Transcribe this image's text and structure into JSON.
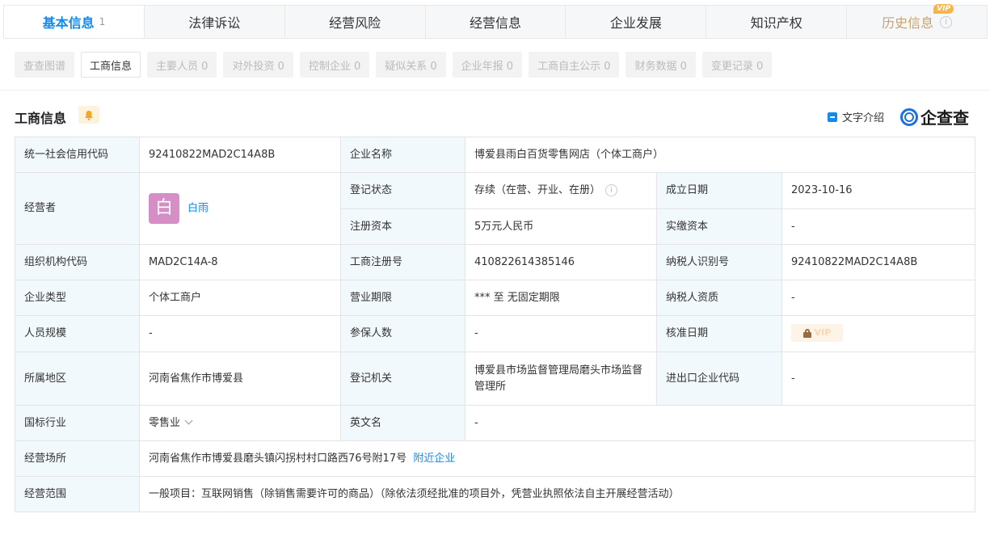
{
  "tabs": [
    {
      "label": "基本信息",
      "count": "1"
    },
    {
      "label": "法律诉讼"
    },
    {
      "label": "经营风险"
    },
    {
      "label": "经营信息"
    },
    {
      "label": "企业发展"
    },
    {
      "label": "知识产权"
    },
    {
      "label": "历史信息",
      "badge": "VIP"
    }
  ],
  "subtabs": [
    "查查图谱",
    "工商信息",
    "主要人员 0",
    "对外投资 0",
    "控制企业 0",
    "疑似关系 0",
    "企业年报 0",
    "工商自主公示 0",
    "财务数据 0",
    "变更记录 0"
  ],
  "section": {
    "title": "工商信息",
    "text_intro": "文字介绍",
    "logo_text": "企查查"
  },
  "info": {
    "credit_code_label": "统一社会信用代码",
    "credit_code": "92410822MAD2C14A8B",
    "company_name_label": "企业名称",
    "company_name": "博爱县雨白百货零售网店（个体工商户）",
    "operator_label": "经营者",
    "operator_avatar": "白",
    "operator_name": "白雨",
    "reg_status_label": "登记状态",
    "reg_status": "存续（在营、开业、在册）",
    "established_label": "成立日期",
    "established": "2023-10-16",
    "reg_capital_label": "注册资本",
    "reg_capital": "5万元人民币",
    "paid_capital_label": "实缴资本",
    "paid_capital": "-",
    "org_code_label": "组织机构代码",
    "org_code": "MAD2C14A-8",
    "reg_no_label": "工商注册号",
    "reg_no": "410822614385146",
    "taxpayer_id_label": "纳税人识别号",
    "taxpayer_id": "92410822MAD2C14A8B",
    "company_type_label": "企业类型",
    "company_type": "个体工商户",
    "business_term_label": "营业期限",
    "business_term": "*** 至 无固定期限",
    "taxpayer_qual_label": "纳税人资质",
    "taxpayer_qual": "-",
    "staff_size_label": "人员规模",
    "staff_size": "-",
    "insured_label": "参保人数",
    "insured": "-",
    "approval_date_label": "核准日期",
    "approval_date_locked": "VIP",
    "region_label": "所属地区",
    "region": "河南省焦作市博爱县",
    "reg_authority_label": "登记机关",
    "reg_authority": "博爱县市场监督管理局磨头市场监督管理所",
    "import_export_label": "进出口企业代码",
    "import_export": "-",
    "industry_label": "国标行业",
    "industry": "零售业",
    "english_name_label": "英文名",
    "english_name": "-",
    "address_label": "经营场所",
    "address": "河南省焦作市博爱县磨头镇闪拐村村口路西76号附17号",
    "nearby_link": "附近企业",
    "scope_label": "经营范围",
    "scope": "一般项目：互联网销售（除销售需要许可的商品）（除依法须经批准的项目外，凭营业执照依法自主开展经营活动）"
  },
  "colors": {
    "accent": "#128bed",
    "label_bg": "#f2f9fc",
    "vip": "#f5b54b"
  }
}
